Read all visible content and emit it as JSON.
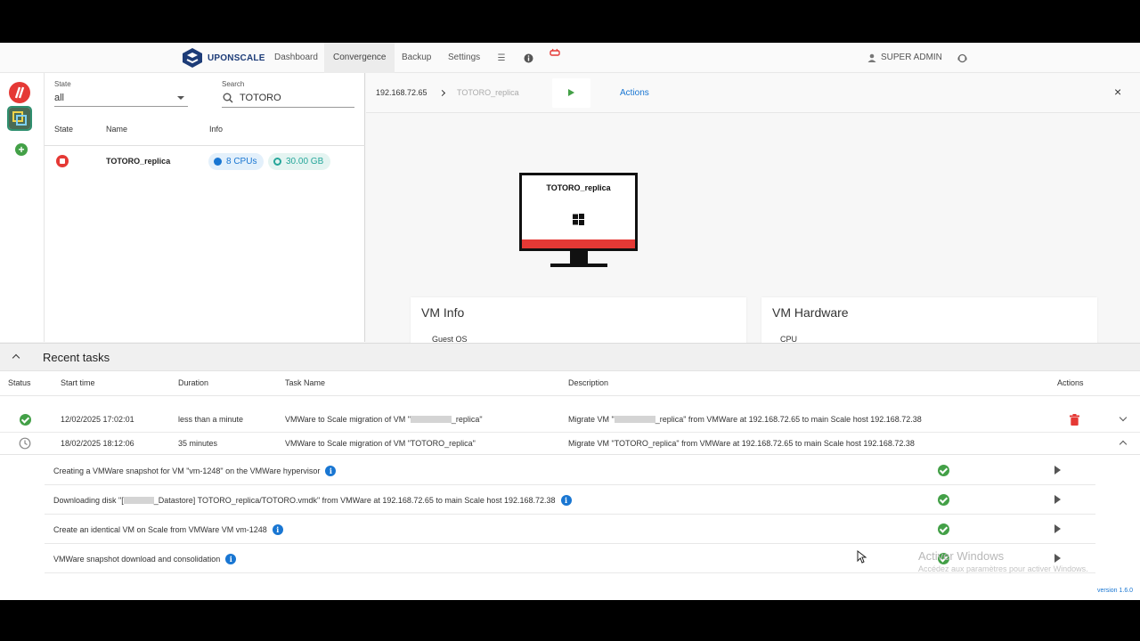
{
  "nav": {
    "brand": "UPONSCALE",
    "dashboard": "Dashboard",
    "convergence": "Convergence",
    "backup": "Backup",
    "settings": "Settings",
    "user": "SUPER ADMIN"
  },
  "filters": {
    "state_label": "State",
    "state_value": "all",
    "search_label": "Search",
    "search_value": "TOTORO"
  },
  "vm_table": {
    "headers": [
      "State",
      "Name",
      "Info"
    ],
    "row": {
      "name": "TOTORO_replica",
      "cpus": "8 CPUs",
      "memory": "30.00 GB"
    }
  },
  "detail": {
    "host": "192.168.72.65",
    "vm_name": "TOTORO_replica",
    "actions": "Actions",
    "monitor_title": "TOTORO_replica",
    "vm_info_title": "VM Info",
    "vm_hardware_title": "VM Hardware",
    "vm_info_peek": "Guest OS",
    "hardware_peek": "CPU"
  },
  "tasks": {
    "title": "Recent tasks",
    "headers": [
      "Status",
      "Start time",
      "Duration",
      "Task Name",
      "Description",
      "Actions"
    ],
    "rows": [
      {
        "start": "12/02/2025 17:02:01",
        "duration": "less than a minute",
        "name_prefix": "VMWare to Scale migration of VM \"",
        "name_suffix": "_replica\"",
        "desc_prefix": "Migrate VM \"",
        "desc_suffix": "_replica\" from VMWare at 192.168.72.65 to main Scale host 192.168.72.38"
      },
      {
        "start": "18/02/2025 18:12:06",
        "duration": "35 minutes",
        "name": "VMWare to Scale migration of VM \"TOTORO_replica\"",
        "desc": "Migrate VM \"TOTORO_replica\" from VMWare at 192.168.72.65 to main Scale host 192.168.72.38"
      }
    ],
    "subtasks": [
      {
        "prefix": "Creating a VMWare snapshot for VM \"vm-1248\" on the VMWare hypervisor",
        "suffix": ""
      },
      {
        "prefix": "Downloading disk \"[",
        "suffix": "_Datastore] TOTORO_replica/TOTORO.vmdk\" from VMWare at 192.168.72.65 to main Scale host 192.168.72.38"
      },
      {
        "prefix": "Create an identical VM on Scale from VMWare VM vm-1248",
        "suffix": ""
      },
      {
        "prefix": "VMWare snapshot download and consolidation",
        "suffix": ""
      }
    ]
  },
  "watermark": {
    "line1": "Activer Windows",
    "line2": "Accédez aux paramètres pour activer Windows."
  },
  "version": "version 1.6.0",
  "colors": {
    "accent": "#1976d2",
    "success": "#43a047",
    "danger": "#e53935",
    "brand": "#1d3c78"
  }
}
